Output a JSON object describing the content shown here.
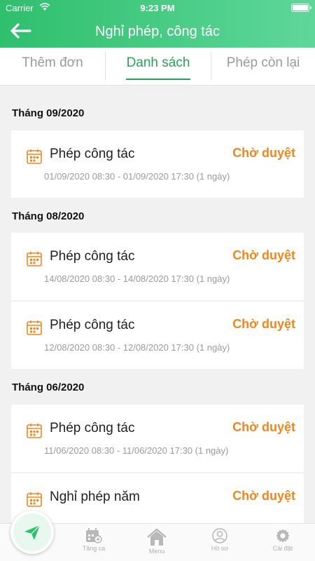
{
  "status_bar": {
    "carrier": "Carrier",
    "time": "9:23 PM"
  },
  "header": {
    "title": "Nghỉ phép, công tác"
  },
  "tabs": [
    {
      "label": "Thêm đơn",
      "active": false
    },
    {
      "label": "Danh sách",
      "active": true
    },
    {
      "label": "Phép còn lại",
      "active": false
    }
  ],
  "sections": [
    {
      "month": "Tháng 09/2020",
      "items": [
        {
          "type": "Phép công tác",
          "status": "Chờ duyệt",
          "range": "01/09/2020 08:30 - 01/09/2020 17:30 (1 ngày)"
        }
      ]
    },
    {
      "month": "Tháng 08/2020",
      "items": [
        {
          "type": "Phép công tác",
          "status": "Chờ duyệt",
          "range": "14/08/2020 08:30 - 14/08/2020 17:30 (1 ngày)"
        },
        {
          "type": "Phép công tác",
          "status": "Chờ duyệt",
          "range": "12/08/2020 08:30 - 12/08/2020 17:30 (1 ngày)"
        }
      ]
    },
    {
      "month": "Tháng 06/2020",
      "items": [
        {
          "type": "Phép công tác",
          "status": "Chờ duyệt",
          "range": "11/06/2020 08:30 - 11/06/2020 17:30 (1 ngày)"
        },
        {
          "type": "Nghỉ phép năm",
          "status": "Chờ duyệt",
          "range": ""
        }
      ]
    }
  ],
  "tabbar": {
    "items": [
      {
        "label": "Tăng ca",
        "icon": "calendar-plus-icon"
      },
      {
        "label": "Menu",
        "icon": "home-icon"
      },
      {
        "label": "Hồ sơ",
        "icon": "user-icon"
      },
      {
        "label": "Cài đặt",
        "icon": "gear-icon"
      }
    ],
    "fab_icon": "send-icon"
  },
  "colors": {
    "primary": "#2fbf6d",
    "accent": "#26a456",
    "pending": "#f0861c"
  }
}
